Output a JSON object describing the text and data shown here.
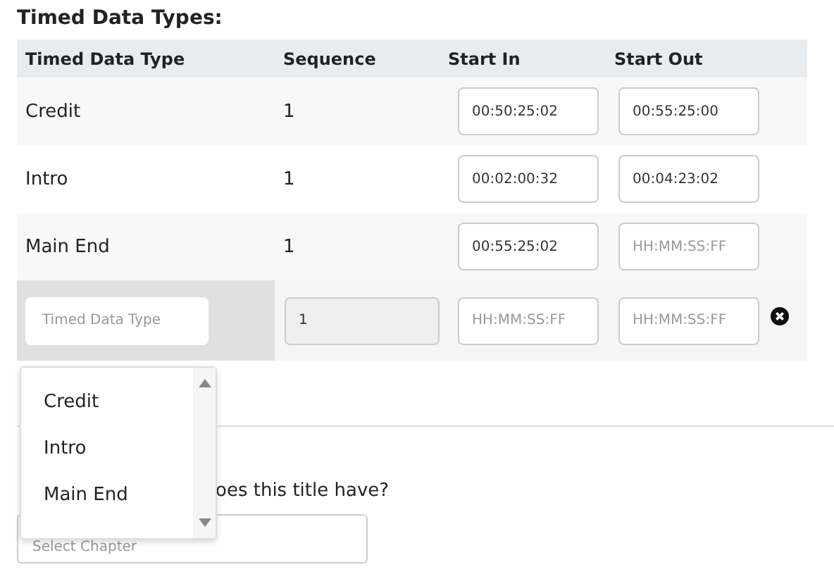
{
  "title": "Timed Data Types:",
  "table": {
    "columns": [
      "Timed Data Type",
      "Sequence",
      "Start In",
      "Start Out"
    ],
    "rows": [
      {
        "type": "Credit",
        "sequence": "1",
        "start_in": {
          "value": "00:50:25:02"
        },
        "start_out": {
          "value": "00:55:25:00"
        }
      },
      {
        "type": "Intro",
        "sequence": "1",
        "start_in": {
          "value": "00:02:00:32"
        },
        "start_out": {
          "value": "00:04:23:02"
        }
      },
      {
        "type": "Main End",
        "sequence": "1",
        "start_in": {
          "value": "00:55:25:02"
        },
        "start_out": {
          "placeholder": "HH:MM:SS:FF"
        }
      }
    ],
    "new_row": {
      "type": {
        "placeholder": "Timed Data Type"
      },
      "sequence": {
        "value": "1",
        "disabled": true
      },
      "start_in": {
        "placeholder": "HH:MM:SS:FF"
      },
      "start_out": {
        "placeholder": "HH:MM:SS:FF"
      }
    }
  },
  "dropdown": {
    "options": [
      "Credit",
      "Intro",
      "Main End"
    ]
  },
  "question": "oes this title have?",
  "chapter_select": {
    "placeholder": "Select Chapter"
  }
}
